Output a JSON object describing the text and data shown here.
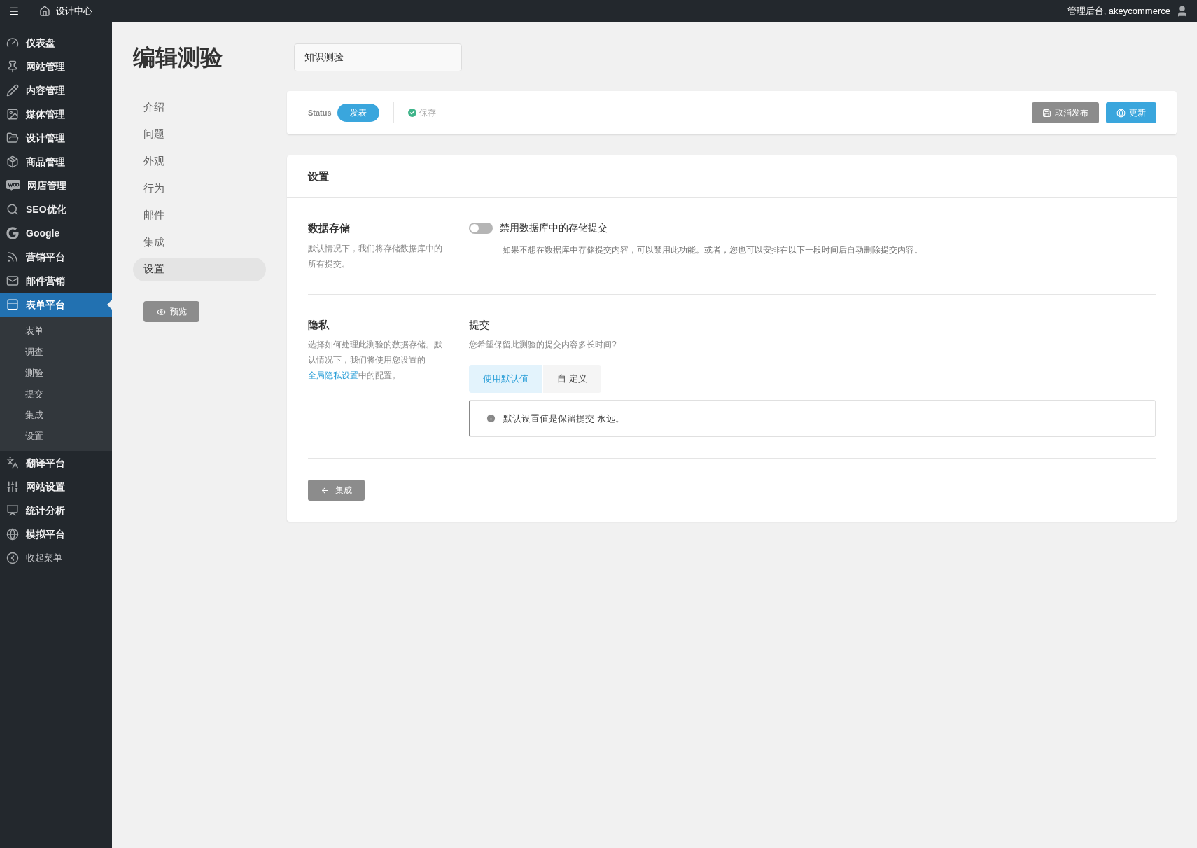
{
  "topbar": {
    "site": "设计中心",
    "account": "管理后台, akeycommerce"
  },
  "sidebar": {
    "items": [
      {
        "label": "仪表盘",
        "selected": false
      },
      {
        "label": "网站管理",
        "selected": false
      },
      {
        "label": "内容管理",
        "selected": false
      },
      {
        "label": "媒体管理",
        "selected": false
      },
      {
        "label": "设计管理",
        "selected": false
      },
      {
        "label": "商品管理",
        "selected": false
      },
      {
        "label": "网店管理",
        "selected": false
      },
      {
        "label": "SEO优化",
        "selected": false
      },
      {
        "label": "Google",
        "selected": false
      },
      {
        "label": "营销平台",
        "selected": false
      },
      {
        "label": "邮件营销",
        "selected": false
      },
      {
        "label": "表单平台",
        "selected": true,
        "children": [
          {
            "label": "表单",
            "selected": false
          },
          {
            "label": "调查",
            "selected": false
          },
          {
            "label": "测验",
            "selected": false
          },
          {
            "label": "提交",
            "selected": false
          },
          {
            "label": "集成",
            "selected": false
          },
          {
            "label": "设置",
            "selected": false
          }
        ]
      },
      {
        "label": "翻译平台",
        "selected": false
      },
      {
        "label": "网站设置",
        "selected": false
      },
      {
        "label": "统计分析",
        "selected": false
      },
      {
        "label": "模拟平台",
        "selected": false
      }
    ],
    "collapse": "收起菜单"
  },
  "page_title": "编辑测验",
  "title_field": {
    "value": "知识测验"
  },
  "section_nav": {
    "items": [
      {
        "label": "介绍",
        "selected": false
      },
      {
        "label": "问题",
        "selected": false
      },
      {
        "label": "外观",
        "selected": false
      },
      {
        "label": "行为",
        "selected": false
      },
      {
        "label": "邮件",
        "selected": false
      },
      {
        "label": "集成",
        "selected": false
      },
      {
        "label": "设置",
        "selected": true
      }
    ],
    "preview_button": "预览"
  },
  "status_bar": {
    "label": "Status",
    "status": "发表",
    "saved": "保存",
    "buttons": [
      {
        "label": "取消发布",
        "kind": "secondary"
      },
      {
        "label": "更新",
        "kind": "primary"
      }
    ]
  },
  "settings": {
    "heading": "设置",
    "data_storage": {
      "title": "数据存储",
      "description": "默认情况下，我们将存储数据库中的所有提交。",
      "toggle": {
        "label": "禁用数据库中的存储提交",
        "on": false
      },
      "help": "如果不想在数据库中存储提交内容，可以禁用此功能。或者，您也可以安排在以下一段时间后自动删除提交内容。"
    },
    "privacy": {
      "title": "隐私",
      "description_before": "选择如何处理此测验的数据存储。默认情况下，我们将使用您设置的",
      "link": "全局隐私设置",
      "description_after": "中的配置。"
    },
    "submissions": {
      "title": "提交",
      "question": "您希望保留此测验的提交内容多长时间?",
      "options": [
        {
          "label": "使用默认值",
          "selected": true
        },
        {
          "label": "自 定义",
          "selected": false
        }
      ],
      "notice": "默认设置值是保留提交 永远。"
    },
    "back_button": "集成"
  }
}
